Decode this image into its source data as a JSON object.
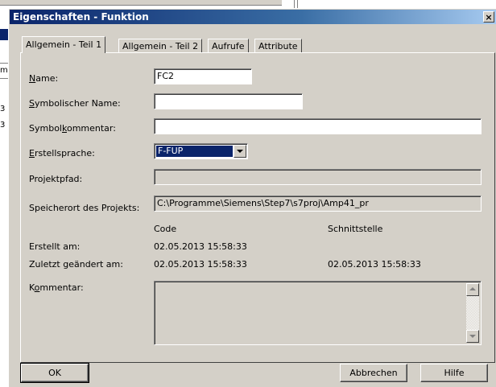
{
  "dialog": {
    "title": "Eigenschaften - Funktion",
    "close_glyph": "×"
  },
  "background": {
    "left_labels": [
      "m",
      "3",
      "3"
    ]
  },
  "tabs": [
    {
      "label": "Allgemein - Teil 1",
      "active": true
    },
    {
      "label": "Allgemein - Teil 2",
      "active": false
    },
    {
      "label": "Aufrufe",
      "active": false
    },
    {
      "label": "Attribute",
      "active": false
    }
  ],
  "form": {
    "name_label_pre": "",
    "name_label_ul": "N",
    "name_label_post": "ame:",
    "name_value": "FC2",
    "symname_label_pre": "",
    "symname_label_ul": "S",
    "symname_label_post": "ymbolischer Name:",
    "symname_value": "",
    "symcomment_label_pre": "Symbol",
    "symcomment_label_ul": "k",
    "symcomment_label_post": "ommentar:",
    "symcomment_value": "",
    "language_label_pre": "",
    "language_label_ul": "E",
    "language_label_post": "rstellsprache:",
    "language_value": "F-FUP",
    "projectpath_label": "Projektpfad:",
    "projectpath_value": "",
    "storage_label": "Speicherort des Projekts:",
    "storage_value": "C:\\Programme\\Siemens\\Step7\\s7proj\\Amp41_pr",
    "col_code": "Code",
    "col_interface": "Schnittstelle",
    "created_label": "Erstellt am:",
    "created_code": "02.05.2013 15:58:33",
    "modified_label": "Zuletzt geändert am:",
    "modified_code": "02.05.2013 15:58:33",
    "modified_interface": "02.05.2013 15:58:33",
    "comment_label_pre": "K",
    "comment_label_ul": "o",
    "comment_label_post": "mmentar:",
    "comment_value": ""
  },
  "buttons": {
    "ok": "OK",
    "cancel": "Abbrechen",
    "help": "Hilfe"
  },
  "colors": {
    "title_bar": "#0a246a",
    "face": "#d4d0c8",
    "selection": "#0a246a"
  }
}
